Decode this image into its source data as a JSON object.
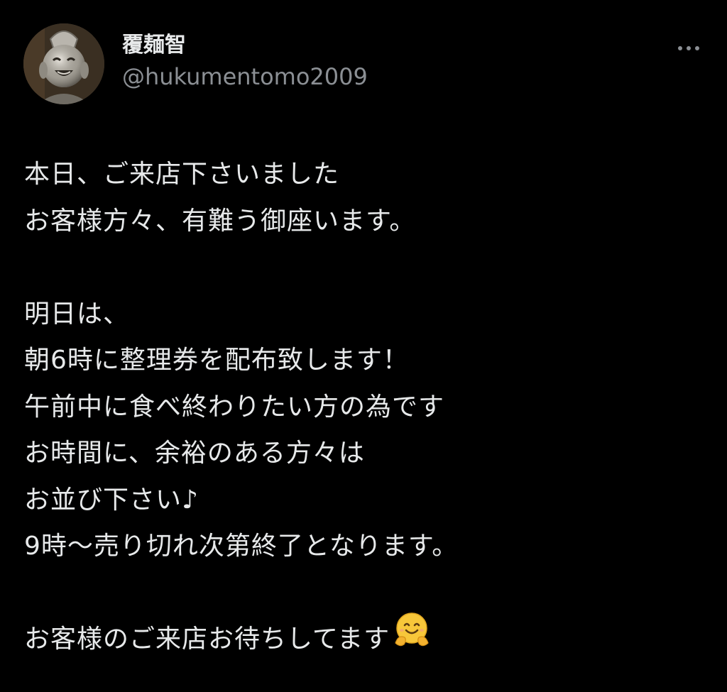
{
  "author": {
    "display_name": "覆麺智",
    "handle": "@hukumentomo2009"
  },
  "more_icon": "more-horizontal-icon",
  "tweet_lines": [
    "本日、ご来店下さいました",
    "お客様方々、有難う御座います。",
    "",
    "明日は、",
    "朝6時に整理券を配布致します！",
    "午前中に食べ終わりたい方の為です",
    "お時間に、余裕のある方々は",
    "お並び下さい♪",
    "9時〜売り切れ次第終了となります。",
    "",
    "お客様のご来店お待ちしてます"
  ],
  "emoji": "hugging-face-emoji",
  "colors": {
    "background": "#000000",
    "text": "#e7e9ea",
    "secondary_text": "#8b8f94"
  }
}
